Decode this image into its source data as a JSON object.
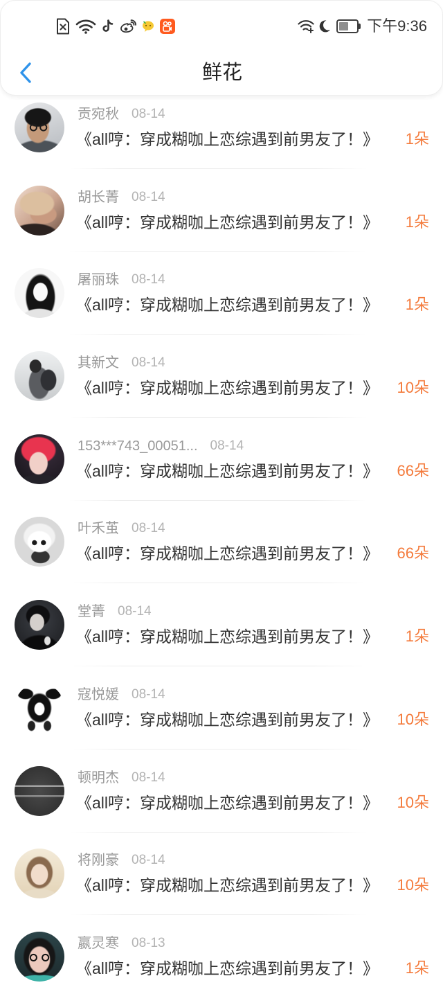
{
  "status_bar": {
    "left_icons": [
      "sim-absent-icon",
      "wifi-icon",
      "tiktok-icon",
      "weibo-icon",
      "chat-bubble-app-icon",
      "kuaishou-icon"
    ],
    "right_icons": [
      "wifi-plus-icon",
      "moon-icon"
    ],
    "battery_level": 0.55,
    "time": "下午9:36"
  },
  "header": {
    "back_icon": "chevron-left-icon",
    "title": "鲜花"
  },
  "theme": {
    "accent": "#2f93ea",
    "count_color": "#f47b3c",
    "text_primary": "#333333",
    "text_secondary": "#999999"
  },
  "gift_list": {
    "items": [
      {
        "user": "贡宛秋",
        "date": "08-14",
        "book": "《all哼：穿成糊咖上恋综遇到前男友了！》",
        "count": "1朵"
      },
      {
        "user": "胡长菁",
        "date": "08-14",
        "book": "《all哼：穿成糊咖上恋综遇到前男友了！》",
        "count": "1朵"
      },
      {
        "user": "屠丽珠",
        "date": "08-14",
        "book": "《all哼：穿成糊咖上恋综遇到前男友了！》",
        "count": "1朵"
      },
      {
        "user": "其新文",
        "date": "08-14",
        "book": "《all哼：穿成糊咖上恋综遇到前男友了！》",
        "count": "10朵"
      },
      {
        "user": "153***743_00051...",
        "date": "08-14",
        "book": "《all哼：穿成糊咖上恋综遇到前男友了！》",
        "count": "66朵"
      },
      {
        "user": "叶禾茧",
        "date": "08-14",
        "book": "《all哼：穿成糊咖上恋综遇到前男友了！》",
        "count": "66朵"
      },
      {
        "user": "堂菁",
        "date": "08-14",
        "book": "《all哼：穿成糊咖上恋综遇到前男友了！》",
        "count": "1朵"
      },
      {
        "user": "寇悦媛",
        "date": "08-14",
        "book": "《all哼：穿成糊咖上恋综遇到前男友了！》",
        "count": "10朵"
      },
      {
        "user": "顿明杰",
        "date": "08-14",
        "book": "《all哼：穿成糊咖上恋综遇到前男友了！》",
        "count": "10朵"
      },
      {
        "user": "将刚豪",
        "date": "08-14",
        "book": "《all哼：穿成糊咖上恋综遇到前男友了！》",
        "count": "10朵"
      },
      {
        "user": "嬴灵寒",
        "date": "08-13",
        "book": "《all哼：穿成糊咖上恋综遇到前男友了！》",
        "count": "1朵"
      }
    ]
  }
}
